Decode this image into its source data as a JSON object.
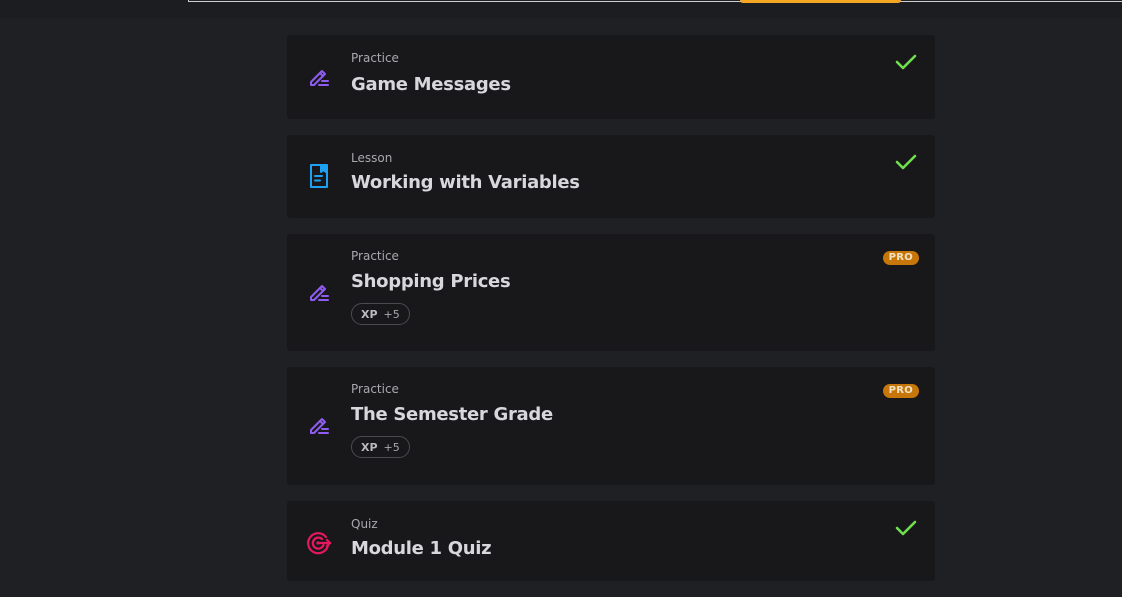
{
  "colors": {
    "background": "#1f2023",
    "card": "#18181b",
    "check": "#6ee04e",
    "pro_badge": "#c7770a",
    "practice_icon": "#8e5cf0",
    "lesson_icon": "#1ea1f2",
    "quiz_icon": "#e8175d"
  },
  "items": [
    {
      "type": "Practice",
      "title": "Game Messages",
      "icon": "pencil-icon",
      "status": "completed"
    },
    {
      "type": "Lesson",
      "title": "Working with Variables",
      "icon": "document-icon",
      "status": "completed"
    },
    {
      "type": "Practice",
      "title": "Shopping Prices",
      "icon": "pencil-icon",
      "badge": "PRO",
      "xp_label": "XP",
      "xp_value": "+5"
    },
    {
      "type": "Practice",
      "title": "The Semester Grade",
      "icon": "pencil-icon",
      "badge": "PRO",
      "xp_label": "XP",
      "xp_value": "+5"
    },
    {
      "type": "Quiz",
      "title": "Module 1 Quiz",
      "icon": "target-icon",
      "status": "completed"
    }
  ]
}
